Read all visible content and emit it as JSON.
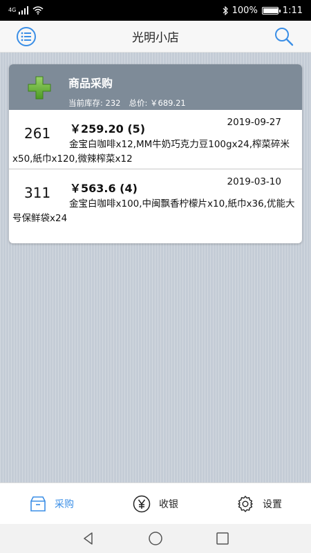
{
  "status_bar": {
    "network": "4G",
    "battery_percent": "100%",
    "time": "1:11"
  },
  "app_bar": {
    "title": "光明小店",
    "left_icon": "menu-list-icon",
    "right_icon": "search-icon"
  },
  "purchase_card": {
    "title": "商品采购",
    "stock_label": "当前库存: 232",
    "total_label": "总价: ￥689.21",
    "rows": [
      {
        "id": "261",
        "price": "￥259.20 (5)",
        "date": "2019-09-27",
        "items": "金宝白咖啡x12,MM牛奶巧克力豆100gx24,榨菜碎米x50,紙巾x120,微辣榨菜x12"
      },
      {
        "id": "311",
        "price": "￥563.6 (4)",
        "date": "2019-03-10",
        "items": "金宝白咖啡x100,中闽飘香柠檬片x10,紙巾x36,优能大号保鲜袋x24"
      }
    ]
  },
  "tabs": [
    {
      "label": "采购",
      "icon": "box-icon",
      "active": true
    },
    {
      "label": "收银",
      "icon": "yen-icon",
      "active": false
    },
    {
      "label": "设置",
      "icon": "gear-icon",
      "active": false
    }
  ],
  "colors": {
    "accent": "#3a8ee6",
    "header_bg": "#7e8b98",
    "content_bg": "#c4ccd6",
    "plus_green": "#6bb43a"
  }
}
